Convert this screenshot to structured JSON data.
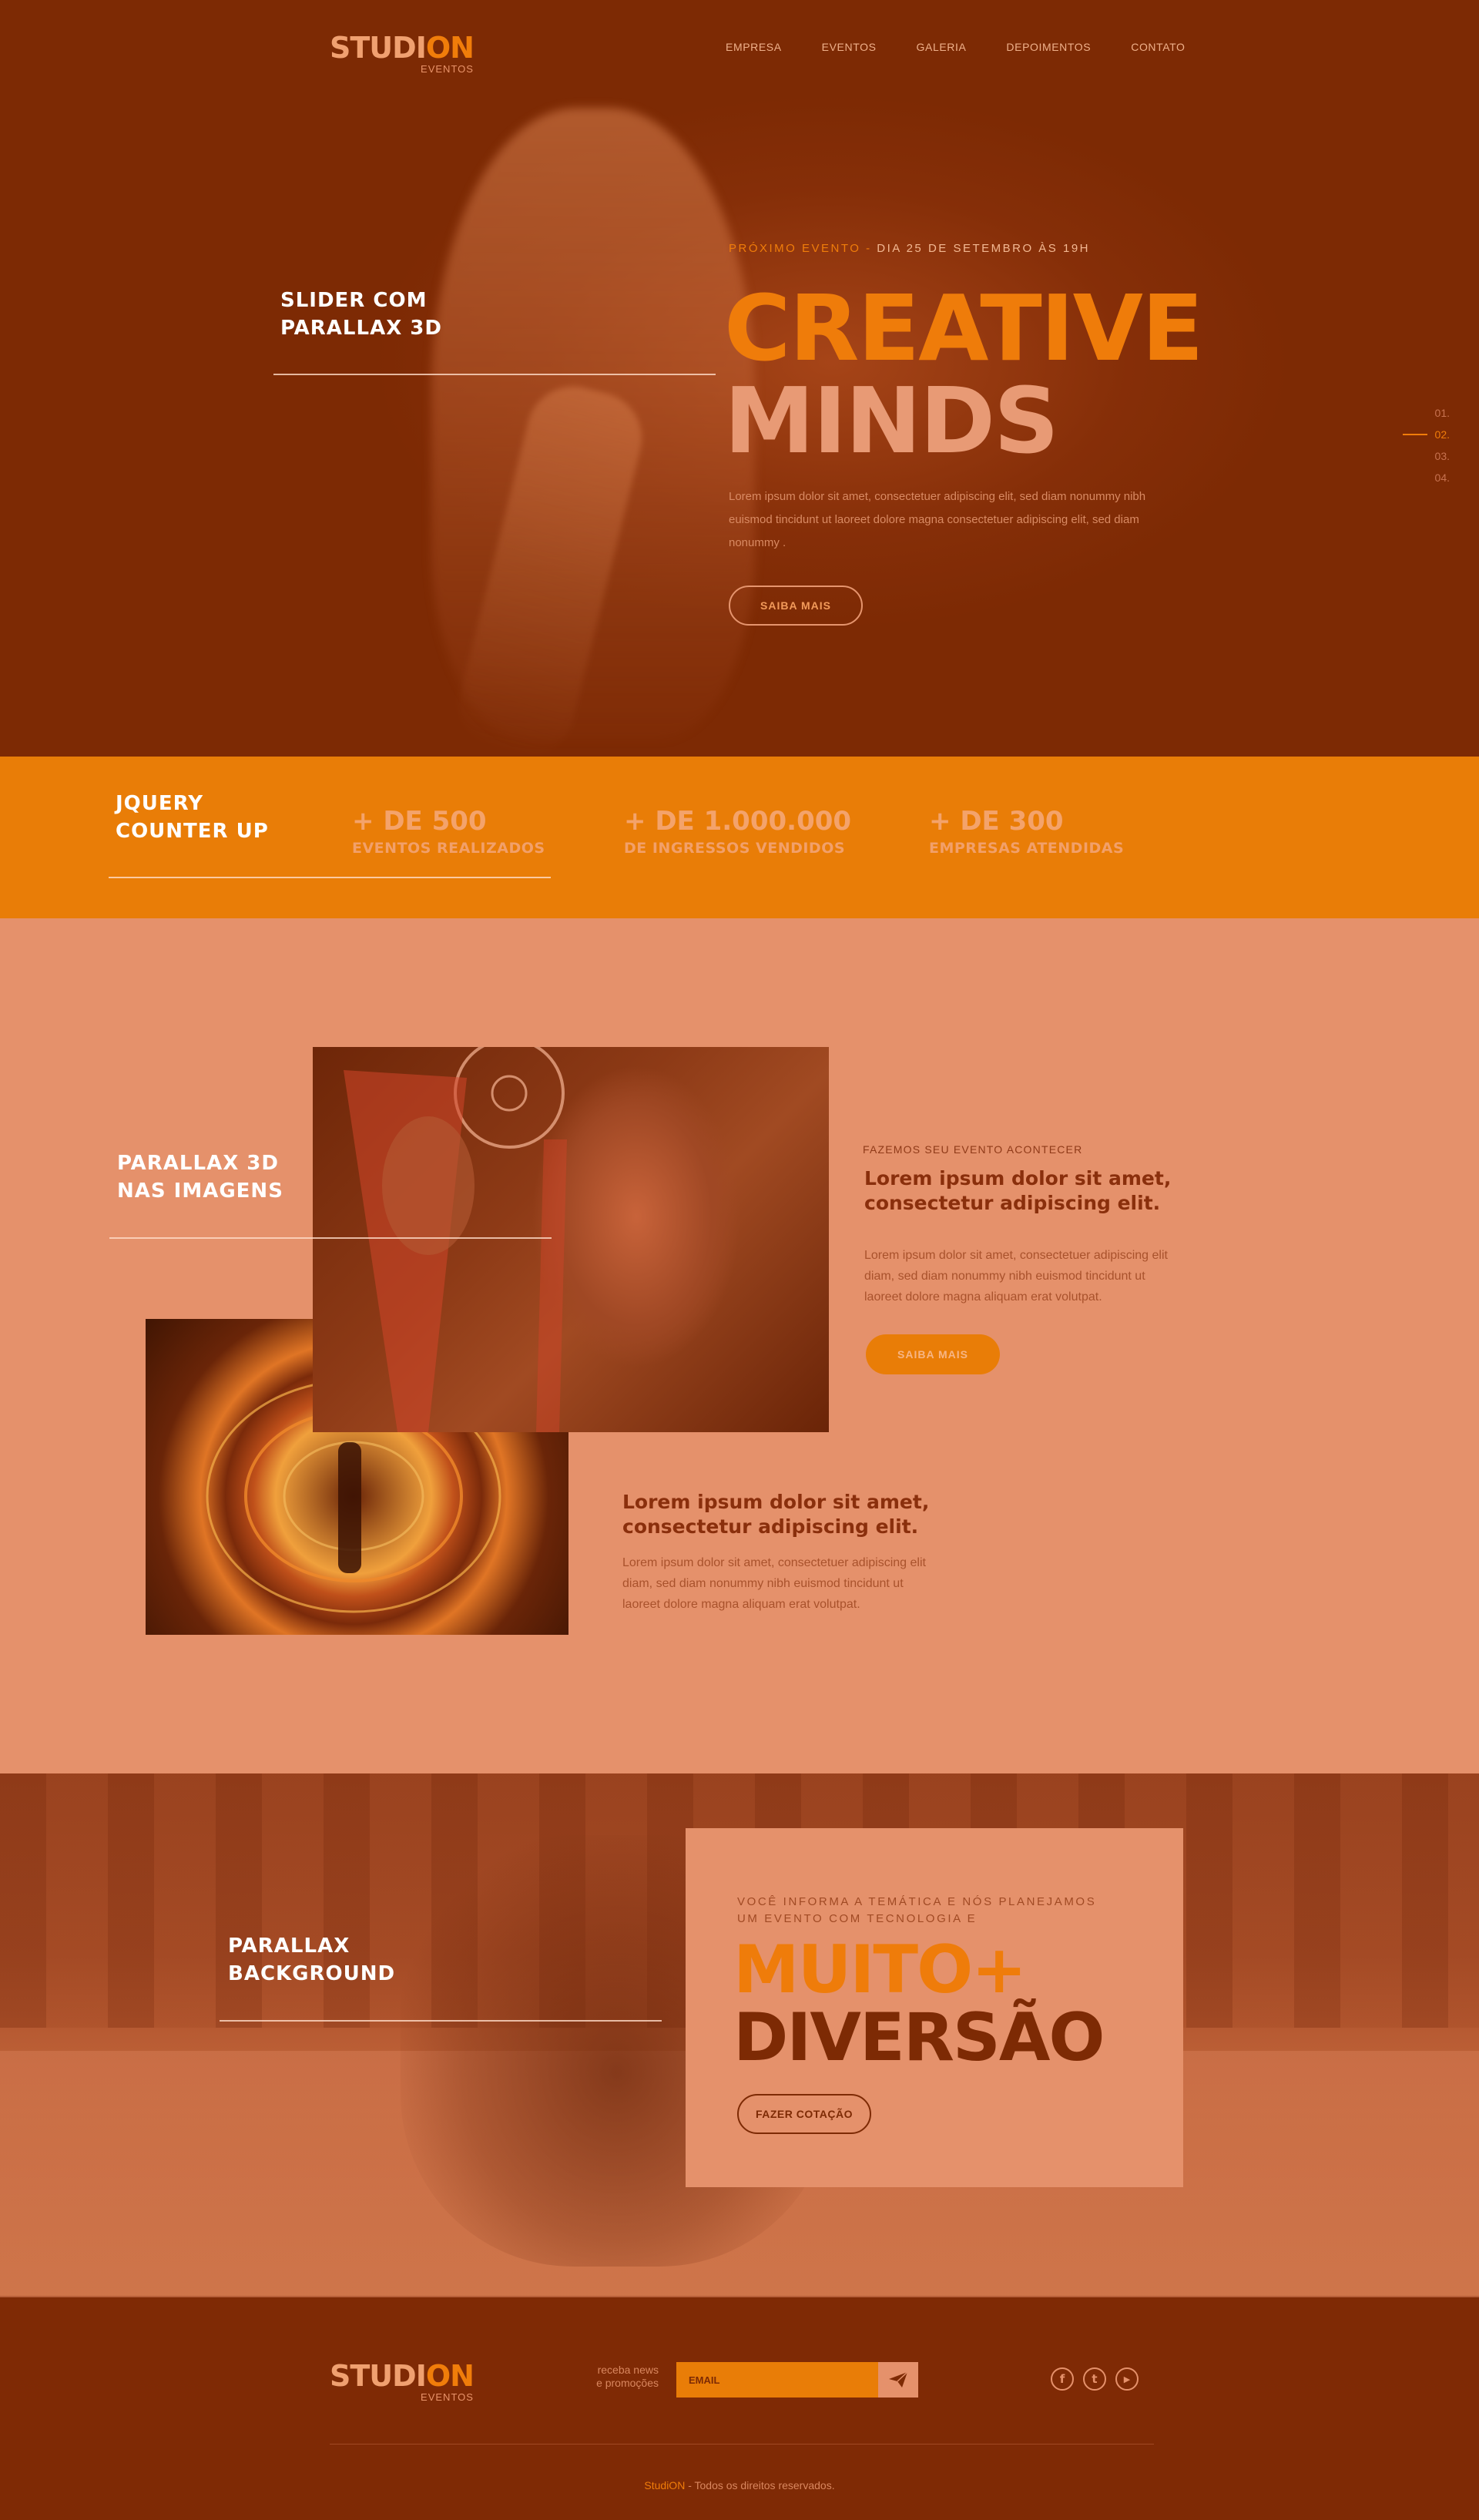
{
  "header": {
    "logo": {
      "part1": "STUDI",
      "part2": "ON",
      "sub": "EVENTOS"
    },
    "nav": [
      "EMPRESA",
      "EVENTOS",
      "GALERIA",
      "DEPOIMENTOS",
      "CONTATO"
    ]
  },
  "hero": {
    "side_title_line1": "SLIDER COM",
    "side_title_line2": "PARALLAX 3D",
    "eyebrow_highlight": "PRÓXIMO EVENTO -",
    "eyebrow_rest": "DIA 25 DE SETEMBRO ÀS 19H",
    "headline1": "CREATIVE",
    "headline2": "MINDS",
    "body": "Lorem ipsum dolor sit amet, consectetuer adipiscing elit, sed diam nonummy nibh euismod tincidunt ut laoreet dolore magna consectetuer adipiscing elit, sed diam nonummy .",
    "button": "SAIBA MAIS",
    "pager": [
      "01.",
      "02.",
      "03.",
      "04."
    ],
    "active_page_index": 1
  },
  "counter": {
    "side_title_line1": "JQUERY",
    "side_title_line2": "COUNTER UP",
    "items": [
      {
        "value": "+ DE 500",
        "label": "EVENTOS REALIZADOS"
      },
      {
        "value": "+ DE 1.000.000",
        "label": "DE INGRESSOS VENDIDOS"
      },
      {
        "value": "+ DE 300",
        "label": "EMPRESAS ATENDIDAS"
      }
    ]
  },
  "images_section": {
    "side_title_line1": "PARALLAX 3D",
    "side_title_line2": "NAS IMAGENS",
    "block1": {
      "eyebrow": "FAZEMOS SEU EVENTO ACONTECER",
      "heading": "Lorem ipsum dolor sit amet, consectetur adipiscing elit.",
      "body": "Lorem ipsum dolor sit amet, consectetuer adipiscing elit diam, sed diam nonummy nibh euismod tincidunt ut laoreet dolore magna aliquam erat volutpat.",
      "button": "SAIBA MAIS"
    },
    "block2": {
      "heading": "Lorem ipsum dolor sit amet, consectetur adipiscing elit.",
      "body": "Lorem ipsum dolor sit amet, consectetuer adipiscing elit diam, sed diam nonummy nibh euismod tincidunt ut laoreet dolore magna aliquam erat volutpat."
    }
  },
  "parallax_bg": {
    "side_title_line1": "PARALLAX",
    "side_title_line2": "BACKGROUND",
    "card": {
      "eyebrow_line1": "VOCÊ INFORMA A TEMÁTICA E NÓS PLANEJAMOS",
      "eyebrow_line2": "UM EVENTO COM TECNOLOGIA E",
      "headline1": "MUITO+",
      "headline2": "DIVERSÃO",
      "button": "FAZER COTAÇÃO"
    }
  },
  "footer": {
    "logo": {
      "part1": "STUDI",
      "part2": "ON",
      "sub": "EVENTOS"
    },
    "newsletter_line1": "receba news",
    "newsletter_line2": "e promoções",
    "email_placeholder": "EMAIL",
    "social": [
      {
        "icon": "facebook-icon",
        "glyph": "f"
      },
      {
        "icon": "twitter-icon",
        "glyph": "t"
      },
      {
        "icon": "youtube-icon",
        "glyph": "▶"
      }
    ],
    "copyright_brand": "StudiON",
    "copyright_rest": "- Todos os direitos reservados."
  },
  "colors": {
    "dark_brown": "#7d2a04",
    "orange": "#ef7c0a",
    "peach": "#e5916b"
  }
}
